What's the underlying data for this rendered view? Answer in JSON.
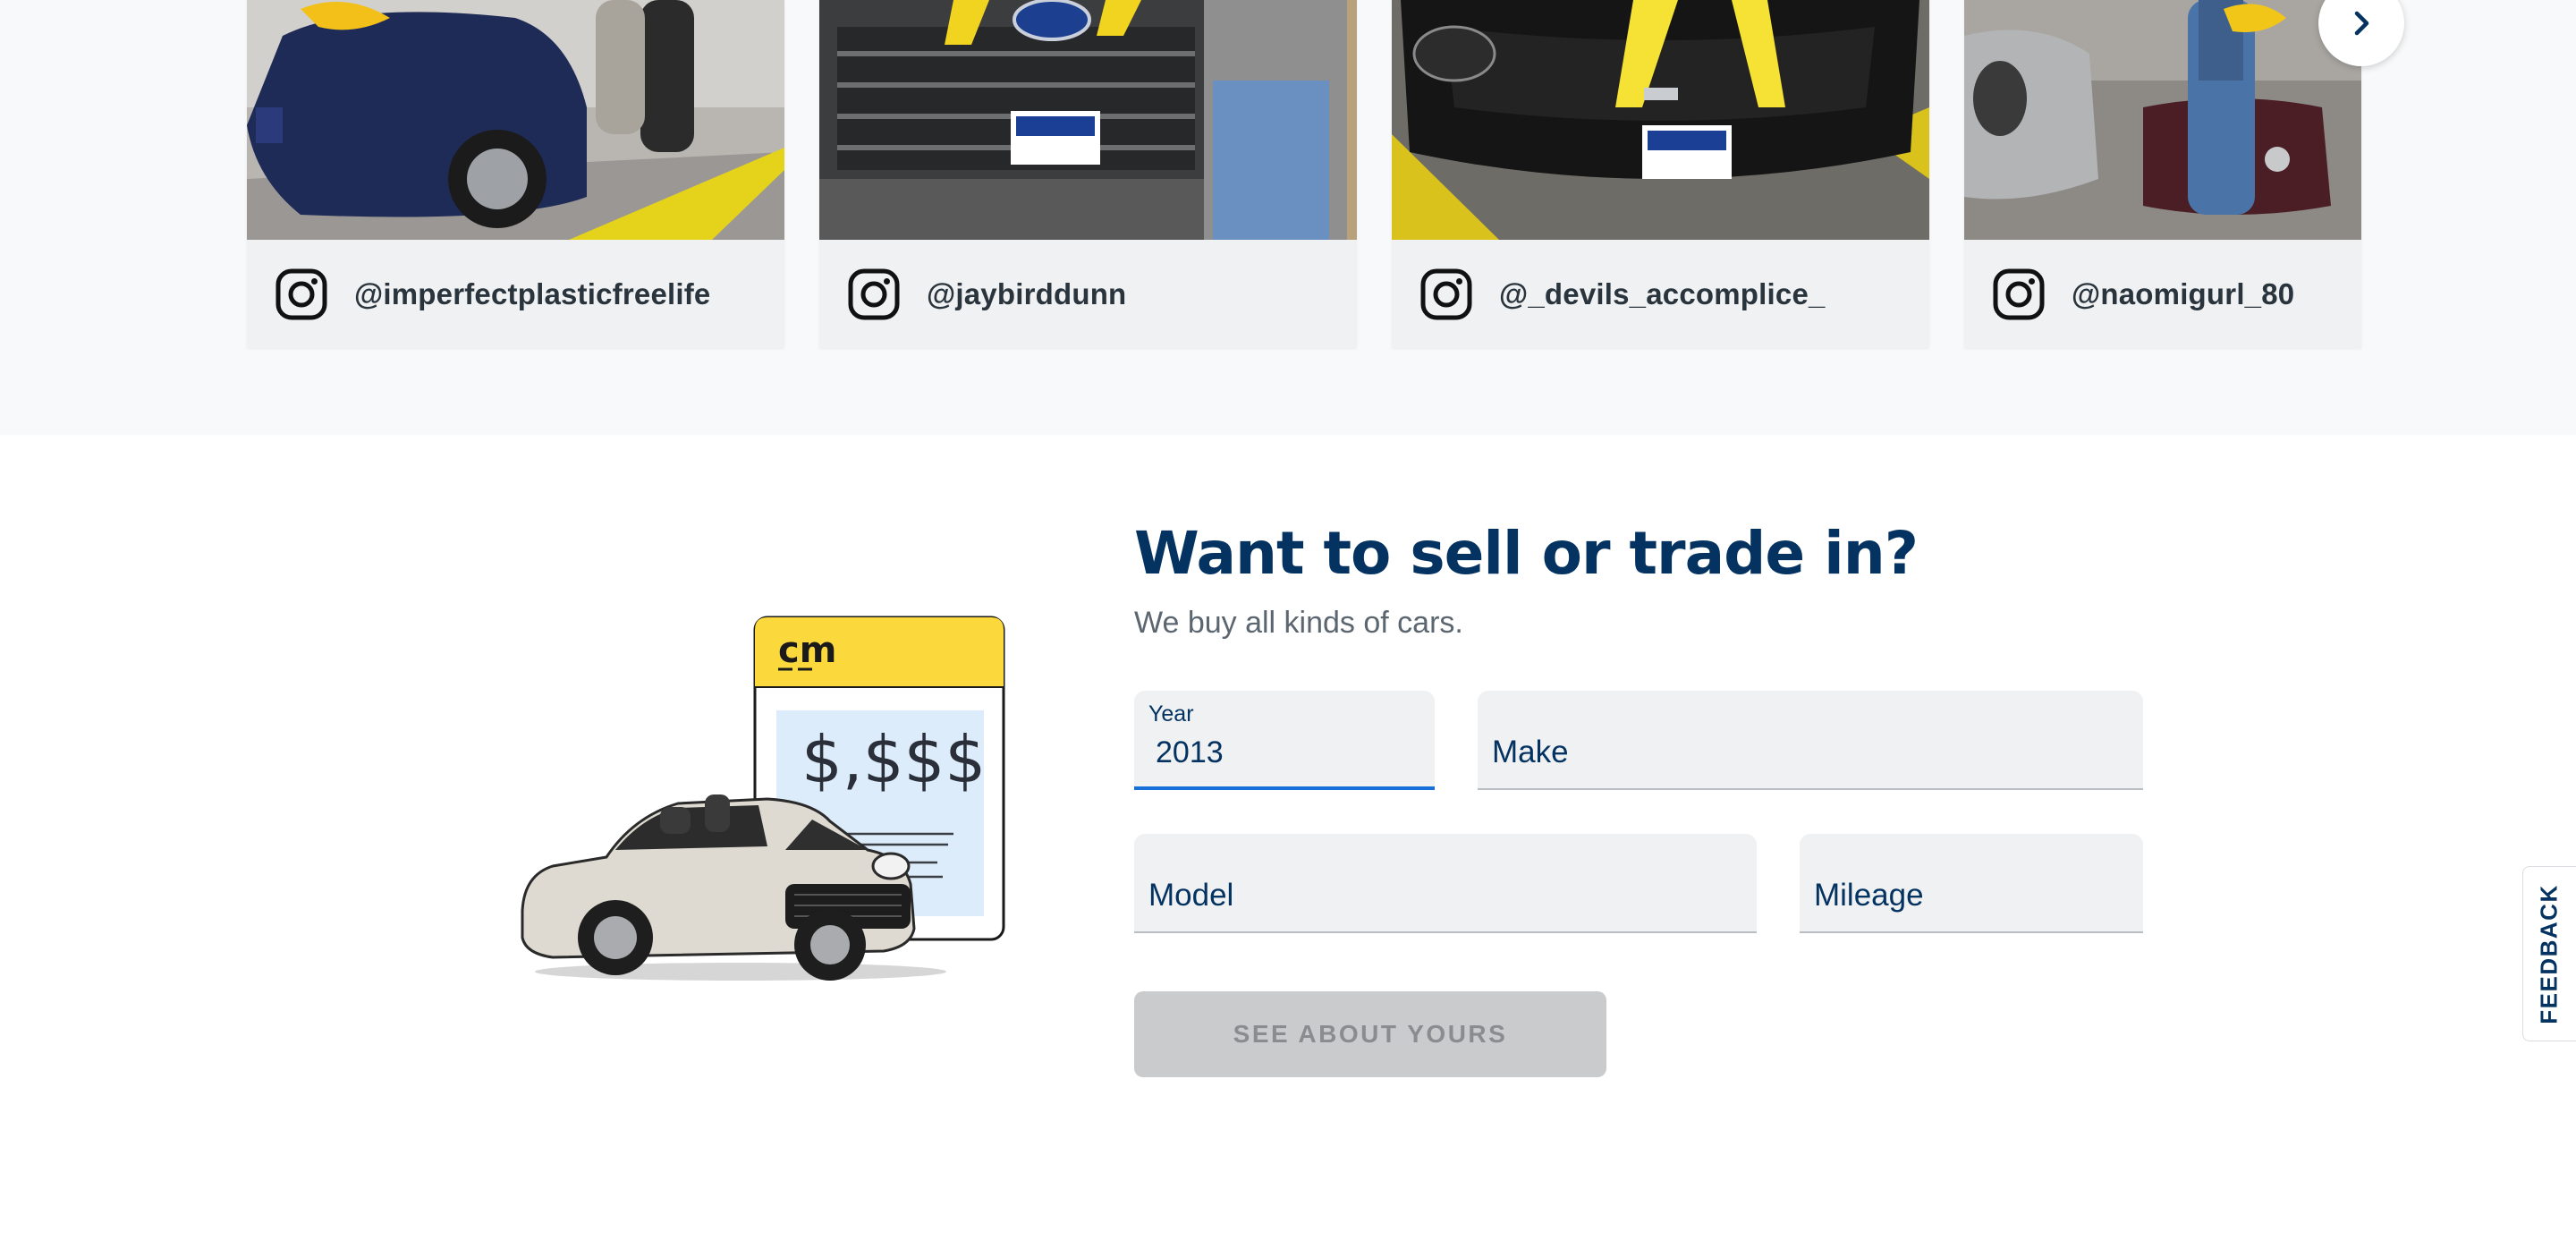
{
  "carousel": {
    "cards": [
      {
        "handle": "@imperfectplasticfreelife"
      },
      {
        "handle": "@jaybirddunn"
      },
      {
        "handle": "@_devils_accomplice_"
      },
      {
        "handle": "@naomigurl_80"
      }
    ],
    "next_icon": "chevron-right-icon"
  },
  "sell": {
    "heading": "Want to sell or trade in?",
    "subheading": "We buy all kinds of cars.",
    "illustration": {
      "logo_text": "cm",
      "price_text": "$,$$$"
    },
    "fields": {
      "year": {
        "label": "Year",
        "value": "2013"
      },
      "make": {
        "placeholder": "Make"
      },
      "model": {
        "placeholder": "Model"
      },
      "mileage": {
        "placeholder": "Mileage"
      }
    },
    "submit_label": "SEE ABOUT YOURS"
  },
  "feedback": {
    "label": "FEEDBACK"
  },
  "colors": {
    "navy": "#053361",
    "accent_blue": "#1770d9",
    "carmax_yellow": "#ffd520",
    "field_bg": "#eff1f3",
    "button_disabled": "#c9cbcd"
  }
}
